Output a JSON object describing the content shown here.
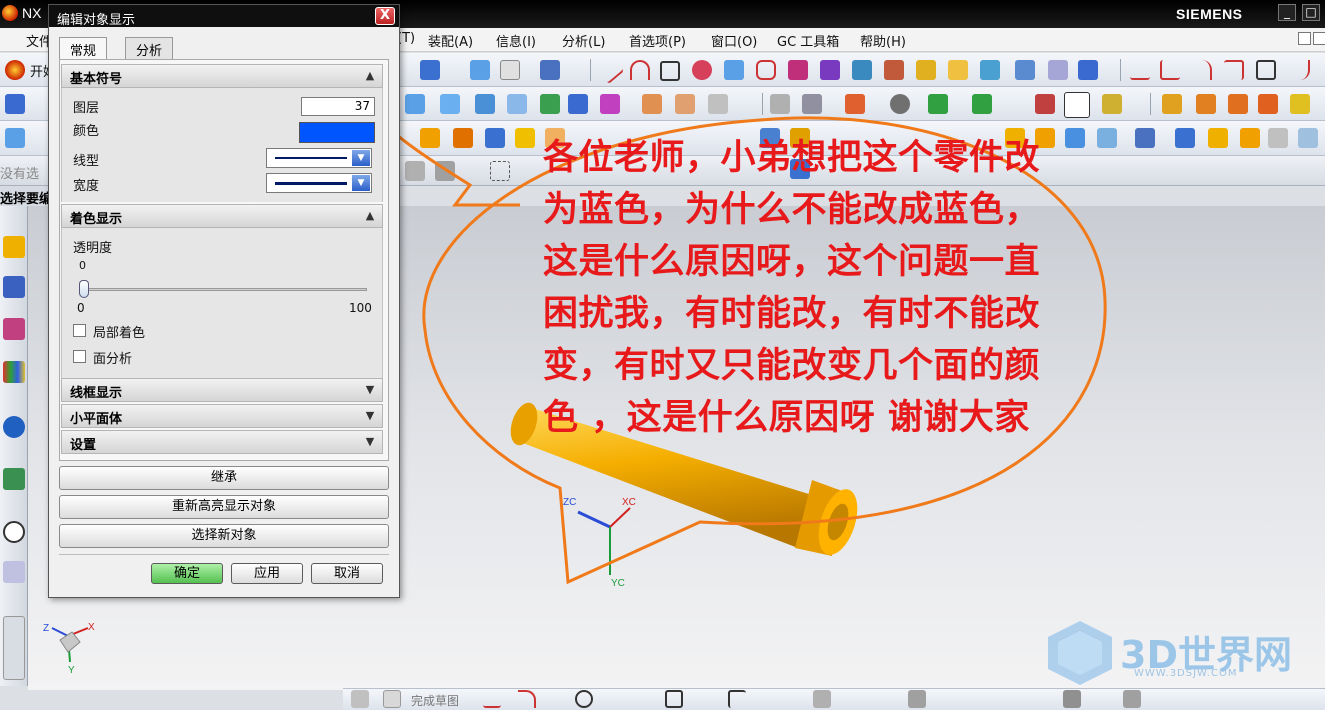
{
  "window": {
    "app_title": "NX",
    "brand": "SIEMENS",
    "controls": [
      "_",
      "□"
    ]
  },
  "menubar": {
    "items_visible": [
      "文件",
      "开始"
    ],
    "items": [
      "(T)",
      "装配(A)",
      "信息(I)",
      "分析(L)",
      "首选项(P)",
      "窗口(O)",
      "GC 工具箱",
      "帮助(H)"
    ]
  },
  "selection": {
    "hint_left": "没有选",
    "prompt": "选择要编"
  },
  "dialog": {
    "title": "编辑对象显示",
    "close": "X",
    "tabs": [
      "常规",
      "分析"
    ],
    "basic_symbol": {
      "header": "基本符号",
      "layer_label": "图层",
      "layer_value": "37",
      "color_label": "颜色",
      "color_value": "#0055ff",
      "linetype_label": "线型",
      "width_label": "宽度"
    },
    "shading": {
      "header": "着色显示",
      "transparency_label": "透明度",
      "slider_current": "0",
      "slider_min": "0",
      "slider_max": "100",
      "partial_shading_label": "局部着色",
      "face_analysis_label": "面分析"
    },
    "collapsed_sections": [
      "线框显示",
      "小平面体",
      "设置"
    ],
    "buttons": {
      "inherit": "继承",
      "rehighlight": "重新高亮显示对象",
      "select_new": "选择新对象",
      "ok": "确定",
      "apply": "应用",
      "cancel": "取消"
    }
  },
  "annotation": {
    "text": "各位老师，小弟想把这个零件改为蓝色，为什么不能改成蓝色，这是什么原因呀，这个问题一直困扰我，有时能改，有时不能改变，有时又只能改变几个面的颜色 ，这是什么原因呀 谢谢大家",
    "lines": [
      "各位老师，小弟想把这个零件改",
      "为蓝色，为什么不能改成蓝色，",
      "这是什么原因呀，这个问题一直",
      "困扰我，有时能改，有时不能改",
      "变，有时又只能改变几个面的颜",
      "色 ，这是什么原因呀  谢谢大家"
    ],
    "color": "#e8191a",
    "balloon_color": "#f07a1a"
  },
  "model": {
    "part_color": "#f0a800",
    "axes": {
      "zc": "ZC",
      "xc": "XC",
      "yc": "YC"
    },
    "triad": {
      "z": "Z",
      "x": "X",
      "y": "Y"
    }
  },
  "bottombar": {
    "finish_sketch": "完成草图"
  },
  "watermark": {
    "text": "3D世界网",
    "url": "WWW.3DSJW.COM"
  }
}
